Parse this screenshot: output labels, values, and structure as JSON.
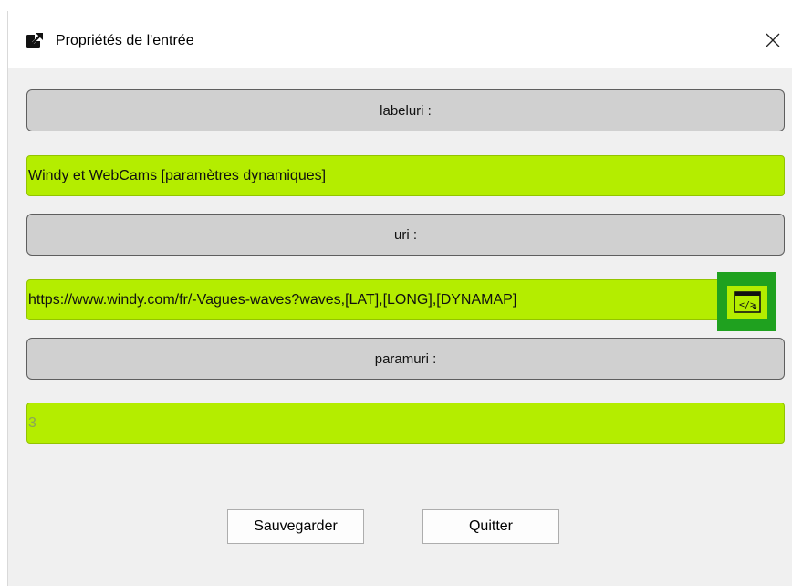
{
  "window": {
    "title": "Propriétés de l'entrée",
    "title_icon": "external-link-icon",
    "close_icon": "close-icon"
  },
  "fields": {
    "labeluri": {
      "label": "labeluri :",
      "value": "Windy et WebCams [paramètres dynamiques]"
    },
    "uri": {
      "label": "uri :",
      "value": "https://www.windy.com/fr/-Vagues-waves?waves,[LAT],[LONG],[DYNAMAP]",
      "action_icon": "code-insert-icon"
    },
    "paramuri": {
      "label": "paramuri :",
      "value": "3"
    }
  },
  "buttons": {
    "save_label": "Sauvegarder",
    "quit_label": "Quitter"
  },
  "colors": {
    "field_bg": "#b4ed00",
    "label_bg": "#d0d0d0",
    "highlight": "#1fa11f"
  }
}
